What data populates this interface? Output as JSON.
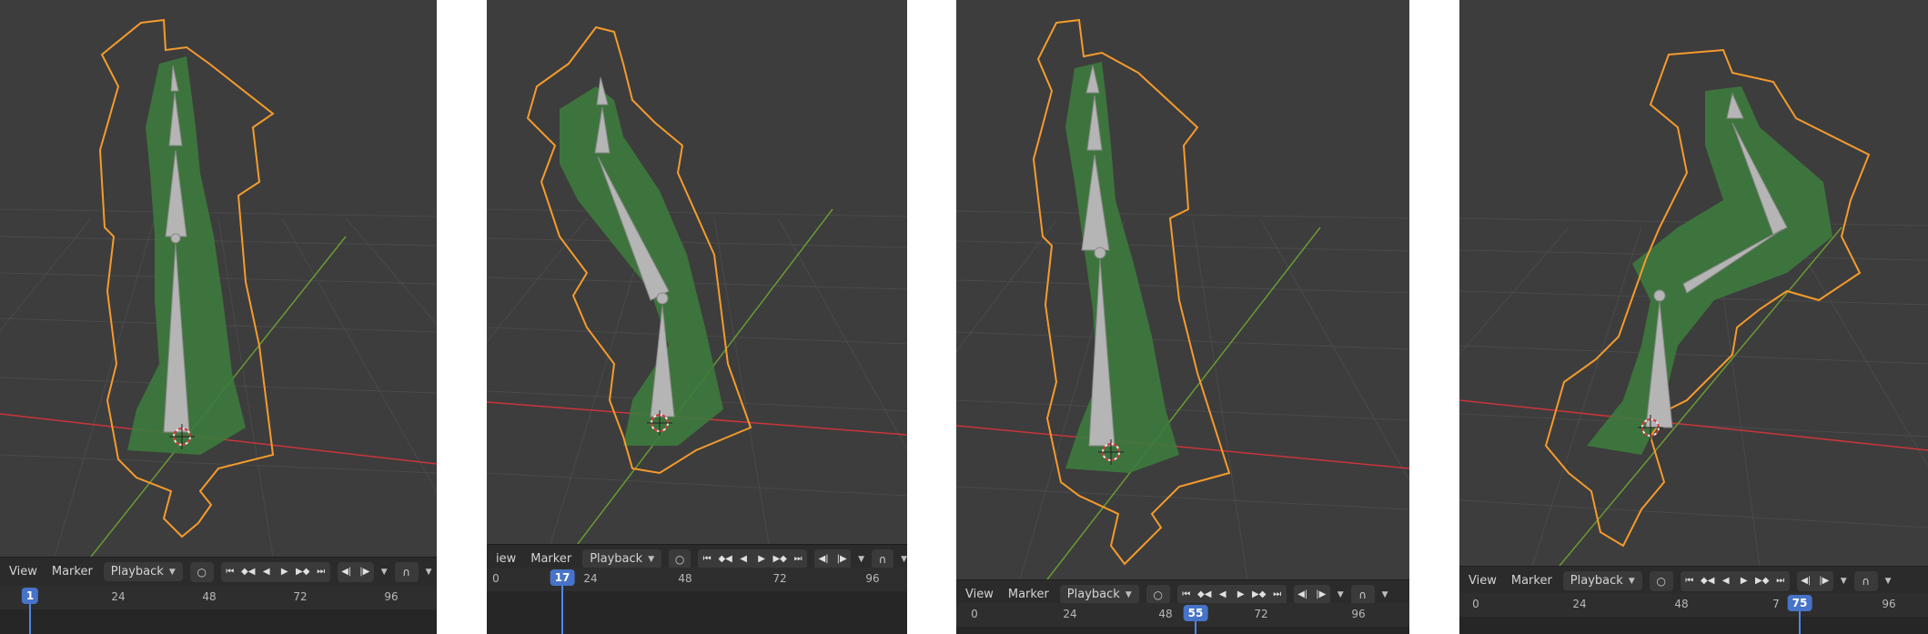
{
  "colors": {
    "viewport_bg": "#3d3d3d",
    "grid": "#4a4a4a",
    "x_axis": "#c9353b",
    "y_axis": "#6a9a34",
    "selection_outline": "#f59b2c",
    "statue": "#3d7a3d",
    "bone": "#b5b5b5",
    "playhead": "#4773c8"
  },
  "timeline": {
    "menus": [
      "View",
      "Marker"
    ],
    "playback_label": "Playback",
    "icons": {
      "keying": "record-circle-icon",
      "jump_start": "jump-to-start-icon",
      "prev_key": "previous-keyframe-icon",
      "play_reverse": "play-reverse-icon",
      "play": "play-icon",
      "next_key": "next-keyframe-icon",
      "jump_end": "jump-to-end-icon",
      "snap": "snap-magnet-icon"
    }
  },
  "panels": [
    {
      "view_label": "View",
      "marker_label": "Marker",
      "playback_label": "Playback",
      "current_frame": "1",
      "ticks": [
        "24",
        "48",
        "72",
        "96"
      ]
    },
    {
      "view_label": "iew",
      "marker_label": "Marker",
      "playback_label": "Playback",
      "current_frame": "17",
      "ticks": [
        "0",
        "24",
        "48",
        "72",
        "96"
      ]
    },
    {
      "view_label": "View",
      "marker_label": "Marker",
      "playback_label": "Playback",
      "current_frame": "55",
      "ticks": [
        "0",
        "24",
        "48",
        "72",
        "96"
      ]
    },
    {
      "view_label": "View",
      "marker_label": "Marker",
      "playback_label": "Playback",
      "current_frame": "75",
      "ticks": [
        "0",
        "24",
        "48",
        "7",
        "96"
      ]
    }
  ]
}
